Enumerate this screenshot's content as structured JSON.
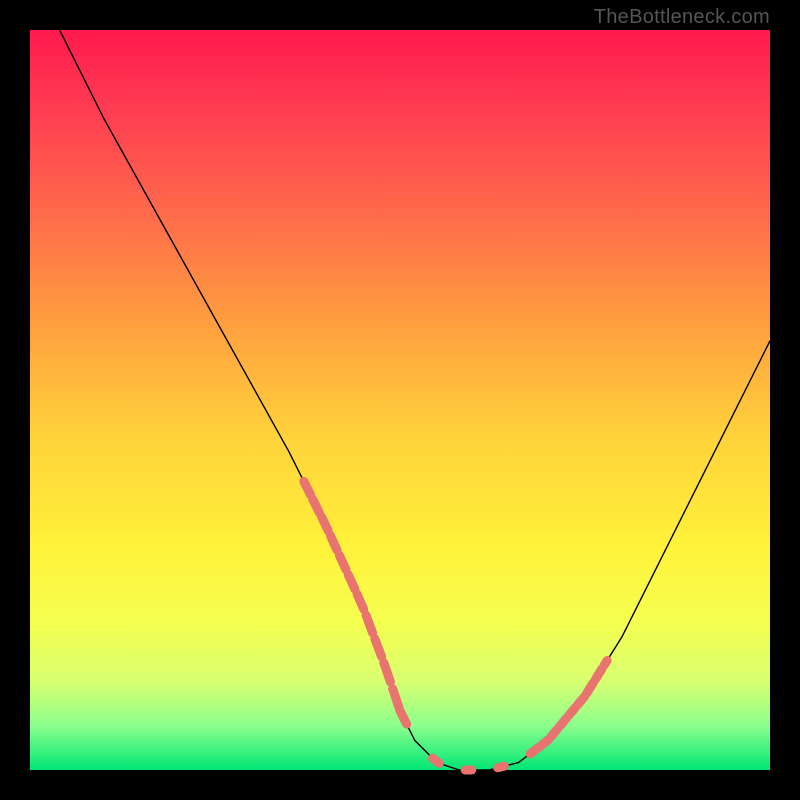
{
  "watermark": "TheBottleneck.com",
  "chart_data": {
    "type": "line",
    "title": "",
    "xlabel": "",
    "ylabel": "",
    "xlim": [
      0,
      100
    ],
    "ylim": [
      0,
      100
    ],
    "series": [
      {
        "name": "curve",
        "x": [
          4,
          10,
          15,
          20,
          25,
          30,
          35,
          40,
          45,
          48,
          50,
          52,
          55,
          58,
          62,
          66,
          70,
          75,
          80,
          85,
          90,
          95,
          100
        ],
        "y": [
          100,
          88,
          79,
          70,
          61,
          52,
          43,
          33,
          22,
          14,
          8,
          4,
          1,
          0,
          0,
          1,
          4,
          10,
          18,
          28,
          38,
          48,
          58
        ]
      }
    ],
    "dotted_segments": [
      {
        "x_range": [
          37,
          50
        ],
        "style": "dense"
      },
      {
        "x_range": [
          50,
          68
        ],
        "style": "sparse"
      },
      {
        "x_range": [
          68,
          78
        ],
        "style": "dense"
      }
    ],
    "dot_color": "#e8736f"
  }
}
